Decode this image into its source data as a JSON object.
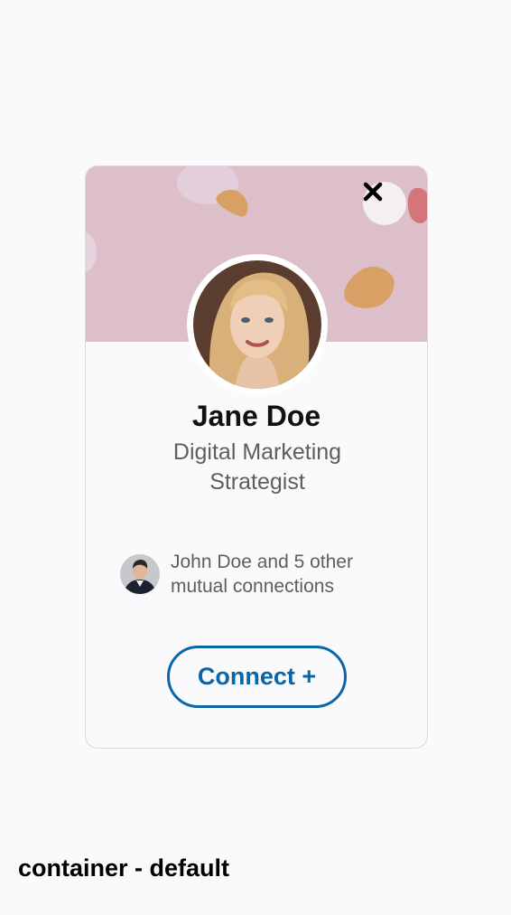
{
  "profile_card": {
    "name": "Jane Doe",
    "job_title": "Digital Marketing Strategist",
    "mutual_connections_text": "John Doe and 5 other mutual connections",
    "connect_button_label": "Connect +"
  },
  "caption": "container - default",
  "icons": {
    "close": "close-icon",
    "avatar": "profile-photo",
    "mutual_avatar": "mutual-connection-photo"
  },
  "colors": {
    "banner": "#dcbfc8",
    "accent": "#0a66a4",
    "background": "#fafafc",
    "secondary_text": "#5e5e5e"
  }
}
